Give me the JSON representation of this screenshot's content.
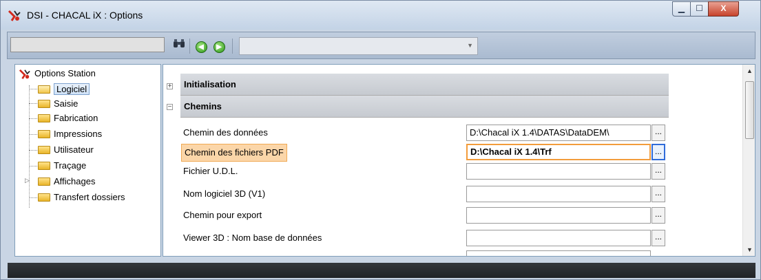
{
  "window": {
    "title": "DSI - CHACAL iX : Options",
    "controls": {
      "minimize": "▁",
      "maximize": "☐",
      "close": "X"
    }
  },
  "toolbar": {
    "search_icon": "binoculars-icon",
    "back_icon": "back-arrow-icon",
    "forward_icon": "forward-arrow-icon",
    "combo_value": ""
  },
  "tree": {
    "root": "Options Station",
    "items": [
      {
        "label": "Logiciel",
        "selected": true
      },
      {
        "label": "Saisie"
      },
      {
        "label": "Fabrication"
      },
      {
        "label": "Impressions"
      },
      {
        "label": "Utilisateur"
      },
      {
        "label": "Traçage"
      },
      {
        "label": "Affichages",
        "expandable": true
      },
      {
        "label": "Transfert dossiers"
      }
    ]
  },
  "properties": {
    "categories": [
      {
        "label": "Initialisation",
        "expanded": false
      },
      {
        "label": "Chemins",
        "expanded": true
      }
    ],
    "rows": [
      {
        "label": "Chemin des données",
        "value": "D:\\Chacal iX 1.4\\DATAS\\DataDEM\\"
      },
      {
        "label": "Chemin des fichiers PDF",
        "value": "D:\\Chacal iX 1.4\\Trf",
        "selected": true
      },
      {
        "label": "Fichier U.D.L.",
        "value": ""
      },
      {
        "label": "Nom logiciel 3D (V1)",
        "value": ""
      },
      {
        "label": "Chemin pour export",
        "value": ""
      },
      {
        "label": "Viewer 3D : Nom base de données",
        "value": ""
      }
    ],
    "button_label": "..."
  }
}
